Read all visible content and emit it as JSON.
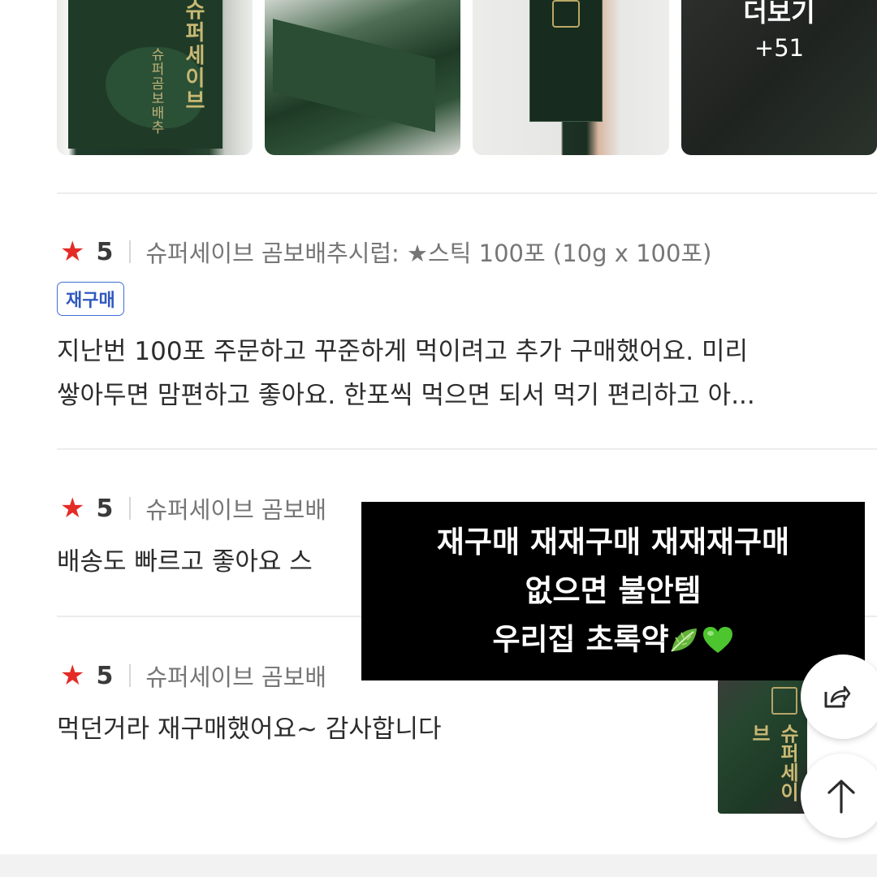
{
  "photos": {
    "more_label": "더보기",
    "more_count": "+51"
  },
  "reviews": [
    {
      "rating": "5",
      "option": "슈퍼세이브 곰보배추시럽: ★스틱 100포 (10g x 100포)",
      "badge": "재구매",
      "lines": [
        "지난번 100포 주문하고 꾸준하게 먹이려고 추가 구매했어요. 미리",
        "쌓아두면 맘편하고 좋아요. 한포씩 먹으면 되서 먹기 편리하고 아..."
      ]
    },
    {
      "rating": "5",
      "option": "슈퍼세이브 곰보배",
      "lines": [
        "배송도 빠르고 좋아요 스"
      ]
    },
    {
      "rating": "5",
      "option": "슈퍼세이브 곰보배",
      "lines": [
        "먹던거라 재구매했어요~ 감사합니다"
      ]
    }
  ],
  "caption": {
    "line1": "재구매 재재구매 재재재구매",
    "line2": "없으면 불안템",
    "line3": "우리집 초록약"
  },
  "icons": {
    "star": "star-icon",
    "leaf": "leafy-green-icon",
    "heart": "green-heart-icon",
    "share": "share-icon",
    "top": "arrow-up-icon"
  },
  "colors": {
    "star": "#e52b25",
    "badge": "#2f58be",
    "caption_bg": "#000000"
  }
}
